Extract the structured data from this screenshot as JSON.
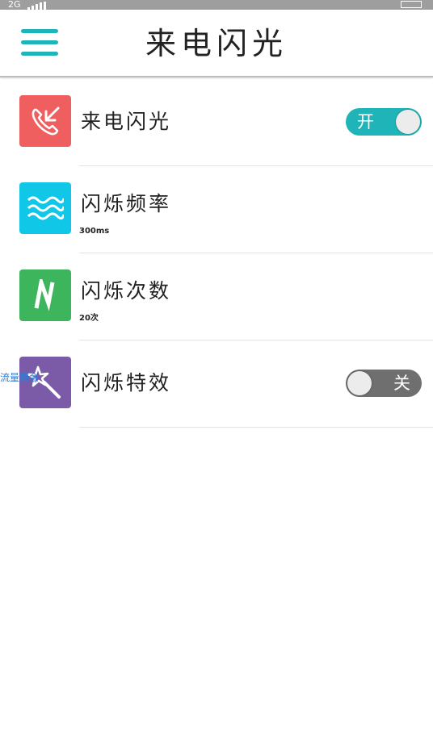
{
  "status_bar": {
    "network": "2G"
  },
  "header": {
    "title": "来电闪光"
  },
  "settings": [
    {
      "label": "来电闪光",
      "icon": "phone-incoming-icon",
      "icon_color": "#ef5f5f",
      "toggle": {
        "state": "on",
        "text": "开"
      }
    },
    {
      "label": "闪烁频率",
      "sublabel": "300ms",
      "icon": "waves-icon",
      "icon_color": "#10c7e8"
    },
    {
      "label": "闪烁次数",
      "sublabel": "20次",
      "icon": "letter-n-icon",
      "icon_color": "#3db55c"
    },
    {
      "label": "闪烁特效",
      "icon": "magic-wand-icon",
      "icon_color": "#7b5ba8",
      "toggle": {
        "state": "off",
        "text": "关"
      }
    }
  ],
  "overlay": {
    "text": "流量剩余"
  },
  "colors": {
    "accent": "#1fb5b8",
    "toggle_off": "#6f6f6f"
  }
}
